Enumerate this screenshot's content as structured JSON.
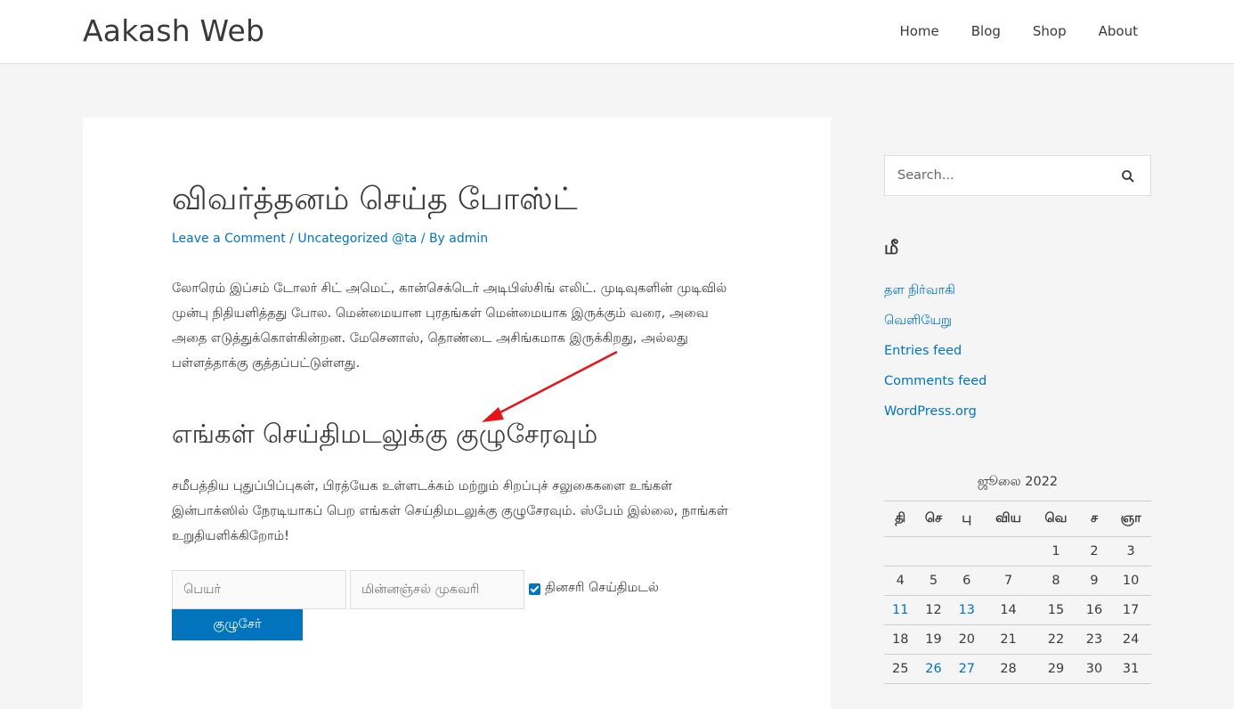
{
  "site": {
    "title": "Aakash Web"
  },
  "nav": {
    "items": [
      "Home",
      "Blog",
      "Shop",
      "About"
    ]
  },
  "post": {
    "title": "விவர்த்தனம் செய்த போஸ்ட்",
    "meta": {
      "comment": "Leave a Comment",
      "category": "Uncategorized @ta",
      "by": "By",
      "author": "admin"
    },
    "paragraph1": "லோரெம் இப்சம் டோலர் சிட் அமெட், கான்செக்டெர் அடிபிஸ்சிங் எலிட். முடிவுகளின் முடிவில் முன்பு நிதியளித்தது போல. மென்மையான புரதங்கள் மென்மையாக இருக்கும் வரை, அவை அதை எடுத்துக்கொள்கின்றன. மேசெனாஸ், தொண்டை அசிங்கமாக இருக்கிறது, அல்லது பள்ளத்தாக்கு குத்தப்பட்டுள்ளது.",
    "heading": "எங்கள் செய்திமடலுக்கு குழுசேரவும்",
    "paragraph2": "சமீபத்திய புதுப்பிப்புகள், பிரத்யேக உள்ளடக்கம் மற்றும் சிறப்புச் சலுகைகளை உங்கள் இன்பாக்ஸில் நேரடியாகப் பெற எங்கள் செய்திமடலுக்கு குழுசேரவும். ஸ்பேம் இல்லை, நாங்கள் உறுதியளிக்கிறோம்!"
  },
  "form": {
    "name_placeholder": "பெயர்",
    "email_placeholder": "மின்னஞ்சல் முகவரி",
    "checkbox_label": "தினசரி செய்திமடல்",
    "checkbox_checked": true,
    "submit_label": "குழுசேர்"
  },
  "sidebar": {
    "search_placeholder": "Search...",
    "meta_title": "மீ",
    "meta_links": [
      "தள நிர்வாகி",
      "வெளியேறு",
      "Entries feed",
      "Comments feed",
      "WordPress.org"
    ],
    "calendar": {
      "caption": "ஜூலை 2022",
      "days": [
        "தி",
        "செ",
        "பு",
        "விய",
        "வெ",
        "ச",
        "ஞா"
      ],
      "weeks": [
        [
          "",
          "",
          "",
          "",
          "1",
          "2",
          "3"
        ],
        [
          "4",
          "5",
          "6",
          "7",
          "8",
          "9",
          "10"
        ],
        [
          "11",
          "12",
          "13",
          "14",
          "15",
          "16",
          "17"
        ],
        [
          "18",
          "19",
          "20",
          "21",
          "22",
          "23",
          "24"
        ],
        [
          "25",
          "26",
          "27",
          "28",
          "29",
          "30",
          "31"
        ]
      ],
      "linked_days": [
        "11",
        "13",
        "26",
        "27"
      ]
    }
  },
  "colors": {
    "accent": "#0274be",
    "annotation_arrow": "#e3161b"
  }
}
